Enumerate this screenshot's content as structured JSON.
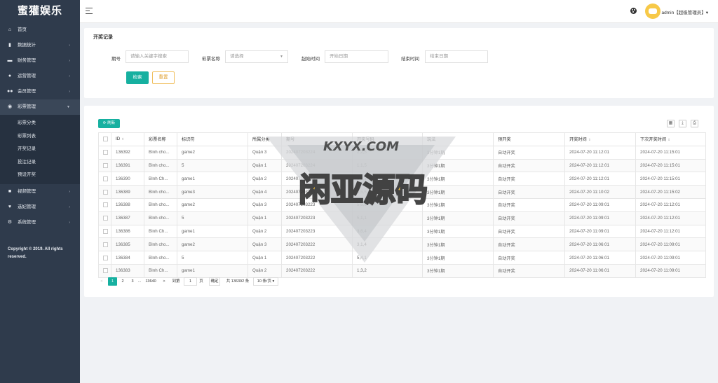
{
  "app": {
    "title": "蜜獾娱乐"
  },
  "sidebar": {
    "items": [
      {
        "label": "首页",
        "icon": "home-icon",
        "has_arrow": false
      },
      {
        "label": "数据统计",
        "icon": "bar-chart-icon",
        "has_arrow": true
      },
      {
        "label": "财务管理",
        "icon": "wallet-icon",
        "has_arrow": true
      },
      {
        "label": "运营管理",
        "icon": "user-icon",
        "has_arrow": true
      },
      {
        "label": "会员管理",
        "icon": "users-icon",
        "has_arrow": true
      },
      {
        "label": "彩票管理",
        "icon": "gamepad-icon",
        "has_arrow": true,
        "open": true
      }
    ],
    "sub_items": [
      "彩票分类",
      "彩票列表",
      "开奖记录",
      "投注记录",
      "预设开奖"
    ],
    "items_after": [
      {
        "label": "视频管理",
        "icon": "video-icon",
        "has_arrow": true
      },
      {
        "label": "选妃管理",
        "icon": "heart-icon",
        "has_arrow": true
      },
      {
        "label": "系统管理",
        "icon": "gear-icon",
        "has_arrow": true
      }
    ],
    "copyright": "Copyright © 2019. All rights reserved."
  },
  "topbar": {
    "user": "admin【超级管理员】▾"
  },
  "search": {
    "title": "开奖记录",
    "fields": [
      {
        "label": "期号",
        "placeholder": "请输入关键字搜索"
      },
      {
        "label": "彩票名称",
        "placeholder": "请选择"
      },
      {
        "label": "起始时间",
        "placeholder": "开始日期"
      },
      {
        "label": "结束时间",
        "placeholder": "结束日期"
      }
    ],
    "search_btn": "检索",
    "reset_btn": "重置"
  },
  "table": {
    "refresh_btn": "刷新",
    "columns": [
      "ID",
      "彩票名称",
      "标识符",
      "所属分类",
      "期号",
      "开奖号码",
      "玩法",
      "预开奖",
      "开奖时间",
      "下次开奖时间"
    ],
    "rows": [
      [
        "136392",
        "Bình cho...",
        "game2",
        "Quận 3",
        "202407203224",
        "2,2,5",
        "3分钟1期",
        "自动开奖",
        "2024-07-20 11:12:01",
        "2024-07-20 11:15:01"
      ],
      [
        "136391",
        "Bình cho...",
        "5",
        "Quận 1",
        "202407203224",
        "1,1,5",
        "3分钟1期",
        "自动开奖",
        "2024-07-20 11:12:01",
        "2024-07-20 11:15:01"
      ],
      [
        "136390",
        "Bình Ch...",
        "game1",
        "Quận 2",
        "202407203224",
        "3,2,1",
        "3分钟1期",
        "自动开奖",
        "2024-07-20 11:12:01",
        "2024-07-20 11:15:01"
      ],
      [
        "136389",
        "Bình cho...",
        "game3",
        "Quận 4",
        "202407203224",
        "3,5,5",
        "3分钟1期",
        "自动开奖",
        "2024-07-20 11:10:02",
        "2024-07-20 11:15:02"
      ],
      [
        "136388",
        "Bình cho...",
        "game2",
        "Quận 3",
        "202407203223",
        "5,6,6",
        "3分钟1期",
        "自动开奖",
        "2024-07-20 11:09:01",
        "2024-07-20 11:12:01"
      ],
      [
        "136387",
        "Bình cho...",
        "5",
        "Quận 1",
        "202407203223",
        "5,1,1",
        "3分钟1期",
        "自动开奖",
        "2024-07-20 11:09:01",
        "2024-07-20 11:12:01"
      ],
      [
        "136386",
        "Bình Ch...",
        "game1",
        "Quận 2",
        "202407203223",
        "3,6,4",
        "3分钟1期",
        "自动开奖",
        "2024-07-20 11:09:01",
        "2024-07-20 11:12:01"
      ],
      [
        "136385",
        "Bình cho...",
        "game2",
        "Quận 3",
        "202407203222",
        "3,1,4",
        "3分钟1期",
        "自动开奖",
        "2024-07-20 11:06:01",
        "2024-07-20 11:09:01"
      ],
      [
        "136384",
        "Bình cho...",
        "5",
        "Quận 1",
        "202407203222",
        "5,4,1",
        "3分钟1期",
        "自动开奖",
        "2024-07-20 11:06:01",
        "2024-07-20 11:09:01"
      ],
      [
        "136383",
        "Bình Ch...",
        "game1",
        "Quận 2",
        "202407203222",
        "1,3,2",
        "3分钟1期",
        "自动开奖",
        "2024-07-20 11:06:01",
        "2024-07-20 11:09:01"
      ]
    ]
  },
  "pager": {
    "prev": "<",
    "pages": [
      "1",
      "2",
      "3"
    ],
    "ellipsis": "...",
    "last": "13640",
    "next": ">",
    "goto_label": "到第",
    "goto_value": "1",
    "page_unit": "页",
    "confirm": "确定",
    "total": "共 136392 条",
    "per_page": "10 条/页 ▾"
  },
  "watermark": {
    "text_top": "KXYX.COM",
    "text_main": "闲亚源码"
  },
  "colors": {
    "primary": "#16b0a0",
    "sidebar": "#2f3b4c",
    "reset": "#e0a030"
  }
}
